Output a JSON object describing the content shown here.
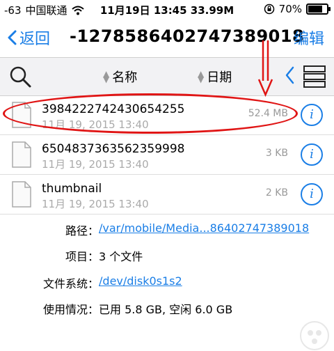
{
  "status_bar": {
    "signal": "-63",
    "carrier": "中国联通",
    "wifi_icon": "wifi-icon",
    "time": "11月19日  13:45  33.99M",
    "battery_percent": "70%",
    "battery_level": 0.7
  },
  "nav": {
    "back_label": "返回",
    "title": "-1278586402747389018",
    "edit_label": "编辑"
  },
  "toolbar": {
    "sort_name_label": "名称",
    "sort_date_label": "日期"
  },
  "files": [
    {
      "name": "3984222742430654255",
      "date": "11月 19, 2015 13:40",
      "size": "52.4 MB"
    },
    {
      "name": "6504837363562359998",
      "date": "11月 19, 2015 13:40",
      "size": "3 KB"
    },
    {
      "name": "thumbnail",
      "date": "11月 19, 2015 13:40",
      "size": "2 KB"
    }
  ],
  "details": {
    "path_label": "路径：",
    "path_value": "/var/mobile/Media...86402747389018",
    "items_label": "项目：",
    "items_value": "3 个文件",
    "fs_label": "文件系统：",
    "fs_value": "/dev/disk0s1s2",
    "usage_label": "使用情况：",
    "usage_value": "已用 5.8 GB, 空闲 6.0 GB"
  },
  "colors": {
    "accent": "#1a7ee6",
    "annotation": "#e01515"
  }
}
